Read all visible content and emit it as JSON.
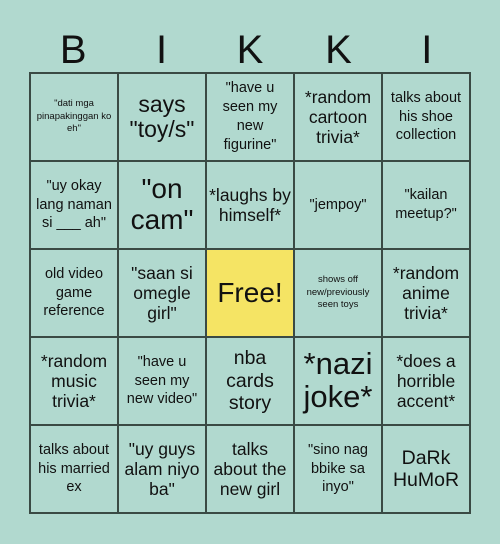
{
  "title_letters": [
    "B",
    "I",
    "K",
    "K",
    "I"
  ],
  "colors": {
    "background": "#b1d9cf",
    "free_cell": "#f5e464",
    "border": "#3a4a44"
  },
  "cells": [
    "\"dati mga pinapakinggan ko eh\"",
    "says \"toy/s\"",
    "\"have u seen my new figurine\"",
    "*random cartoon trivia*",
    "talks about his shoe collection",
    "\"uy okay lang naman si ___ ah\"",
    "\"on cam\"",
    "*laughs by himself*",
    "\"jempoy\"",
    "\"kailan meetup?\"",
    "old video game reference",
    "\"saan si omegle girl\"",
    "Free!",
    "shows off new/previously seen toys",
    "*random anime trivia*",
    "*random music trivia*",
    "\"have u seen my new video\"",
    "nba cards story",
    "*nazi joke*",
    "*does a horrible accent*",
    "talks about his married ex",
    "\"uy guys alam niyo ba\"",
    "talks about the new girl",
    "\"sino nag bbike sa inyo\"",
    "DaRk HuMoR"
  ]
}
